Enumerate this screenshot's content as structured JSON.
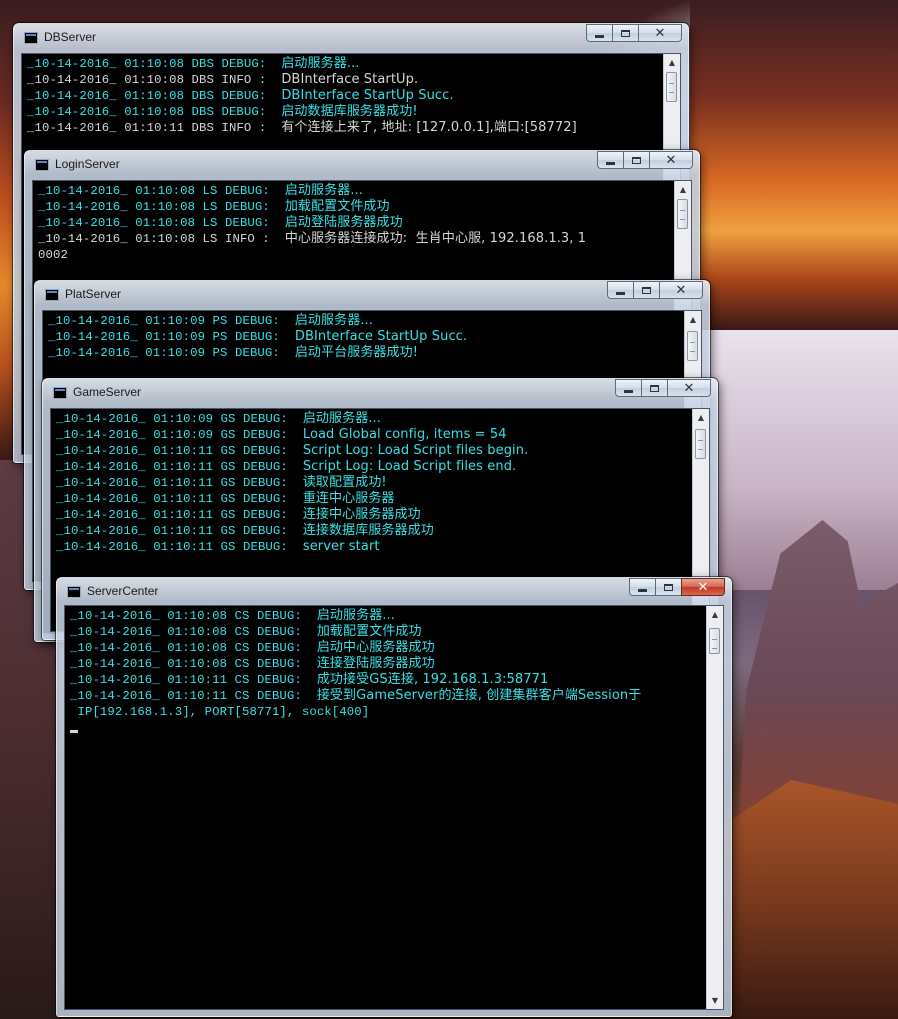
{
  "windows": {
    "dbserver": {
      "title": "DBServer",
      "lines": [
        {
          "text": "_10-14-2016_ 01:10:08 DBS DEBUG:  ",
          "msg": "启动服务器...",
          "color": "cyan"
        },
        {
          "text": "_10-14-2016_ 01:10:08 DBS INFO :  ",
          "msg": "DBInterface StartUp.",
          "color": "white"
        },
        {
          "text": "_10-14-2016_ 01:10:08 DBS DEBUG:  ",
          "msg": "DBInterface StartUp Succ.",
          "color": "cyan"
        },
        {
          "text": "_10-14-2016_ 01:10:08 DBS DEBUG:  ",
          "msg": "启动数据库服务器成功!",
          "color": "cyan"
        },
        {
          "text": "_10-14-2016_ 01:10:11 DBS INFO :  ",
          "msg": "有个连接上来了, 地址: [127.0.0.1],端口:[58772]",
          "color": "white"
        }
      ]
    },
    "loginserver": {
      "title": "LoginServer",
      "lines": [
        {
          "text": "_10-14-2016_ 01:10:08 LS DEBUG:  ",
          "msg": "启动服务器...",
          "color": "cyan"
        },
        {
          "text": "_10-14-2016_ 01:10:08 LS DEBUG:  ",
          "msg": "加载配置文件成功",
          "color": "cyan"
        },
        {
          "text": "_10-14-2016_ 01:10:08 LS DEBUG:  ",
          "msg": "启动登陆服务器成功",
          "color": "cyan"
        },
        {
          "text": "_10-14-2016_ 01:10:08 LS INFO :  ",
          "msg": "中心服务器连接成功:  生肖中心服, 192.168.1.3, 1",
          "color": "white"
        },
        {
          "text": "0002",
          "msg": "",
          "color": "white"
        }
      ]
    },
    "platserver": {
      "title": "PlatServer",
      "lines": [
        {
          "text": "_10-14-2016_ 01:10:09 PS DEBUG:  ",
          "msg": "启动服务器...",
          "color": "cyan"
        },
        {
          "text": "_10-14-2016_ 01:10:09 PS DEBUG:  ",
          "msg": "DBInterface StartUp Succ.",
          "color": "cyan"
        },
        {
          "text": "_10-14-2016_ 01:10:09 PS DEBUG:  ",
          "msg": "启动平台服务器成功!",
          "color": "cyan"
        }
      ]
    },
    "gameserver": {
      "title": "GameServer",
      "lines": [
        {
          "text": "_10-14-2016_ 01:10:09 GS DEBUG:  ",
          "msg": "启动服务器...",
          "color": "cyan"
        },
        {
          "text": "_10-14-2016_ 01:10:09 GS DEBUG:  ",
          "msg": "Load Global config, items = 54",
          "color": "cyan"
        },
        {
          "text": "_10-14-2016_ 01:10:11 GS DEBUG:  ",
          "msg": "Script Log: Load Script files begin.",
          "color": "cyan"
        },
        {
          "text": "_10-14-2016_ 01:10:11 GS DEBUG:  ",
          "msg": "Script Log: Load Script files end.",
          "color": "cyan"
        },
        {
          "text": "_10-14-2016_ 01:10:11 GS DEBUG:  ",
          "msg": "读取配置成功!",
          "color": "cyan"
        },
        {
          "text": "_10-14-2016_ 01:10:11 GS DEBUG:  ",
          "msg": "重连中心服务器",
          "color": "cyan"
        },
        {
          "text": "_10-14-2016_ 01:10:11 GS DEBUG:  ",
          "msg": "连接中心服务器成功",
          "color": "cyan"
        },
        {
          "text": "_10-14-2016_ 01:10:11 GS DEBUG:  ",
          "msg": "连接数据库服务器成功",
          "color": "cyan"
        },
        {
          "text": "_10-14-2016_ 01:10:11 GS DEBUG:  ",
          "msg": "server start",
          "color": "cyan"
        }
      ]
    },
    "servercenter": {
      "title": "ServerCenter",
      "lines": [
        {
          "text": "_10-14-2016_ 01:10:08 CS DEBUG:  ",
          "msg": "启动服务器...",
          "color": "cyan"
        },
        {
          "text": "_10-14-2016_ 01:10:08 CS DEBUG:  ",
          "msg": "加载配置文件成功",
          "color": "cyan"
        },
        {
          "text": "_10-14-2016_ 01:10:08 CS DEBUG:  ",
          "msg": "启动中心服务器成功",
          "color": "cyan"
        },
        {
          "text": "_10-14-2016_ 01:10:08 CS DEBUG:  ",
          "msg": "连接登陆服务器成功",
          "color": "cyan"
        },
        {
          "text": "_10-14-2016_ 01:10:11 CS DEBUG:  ",
          "msg": "成功接受GS连接, 192.168.1.3:58771",
          "color": "cyan"
        },
        {
          "text": "_10-14-2016_ 01:10:11 CS DEBUG:  ",
          "msg": "接受到GameServer的连接, 创建集群客户端Session于",
          "color": "cyan"
        },
        {
          "text": " IP[192.168.1.3], PORT[58771], sock[400]",
          "msg": "",
          "color": "cyan"
        }
      ]
    }
  },
  "colors": {
    "console_bg": "#000000",
    "debug_text": "#38e0e6",
    "info_text": "#d6d6d6",
    "close_active": "#c0392b"
  },
  "icons": {
    "app": "console-icon",
    "minimize": "minimize-icon",
    "maximize": "maximize-icon",
    "close": "close-icon",
    "scroll_up": "scroll-up-arrow-icon",
    "scroll_down": "scroll-down-arrow-icon"
  }
}
